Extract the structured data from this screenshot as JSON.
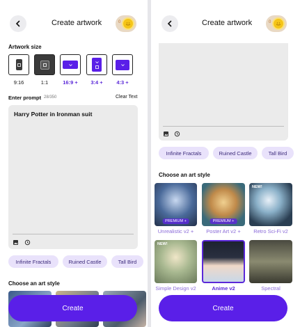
{
  "header": {
    "title": "Create artwork",
    "credits": "0"
  },
  "left": {
    "artwork_size_label": "Artwork size",
    "sizes": [
      {
        "ratio": "9:16",
        "pro": false,
        "selected": false
      },
      {
        "ratio": "1:1",
        "pro": false,
        "selected": true
      },
      {
        "ratio": "16:9 +",
        "pro": true,
        "selected": false
      },
      {
        "ratio": "3:4 +",
        "pro": true,
        "selected": false
      },
      {
        "ratio": "4:3 +",
        "pro": true,
        "selected": false
      }
    ],
    "prompt_label": "Enter prompt",
    "prompt_count": "28/350",
    "clear_text": "Clear Text",
    "prompt_value": "Harry Potter in Ironman suit",
    "chips": [
      "Infinite Fractals",
      "Ruined Castle",
      "Tall Bird"
    ],
    "art_style_label": "Choose an art style",
    "create_label": "Create"
  },
  "right": {
    "chips": [
      "Infinite Fractals",
      "Ruined Castle",
      "Tall Bird"
    ],
    "art_style_label": "Choose an art style",
    "styles": [
      {
        "name": "Unrealistic v2 +",
        "badge": "PREMIUM +",
        "is_new": false,
        "selected": false
      },
      {
        "name": "Poster Art v2 +",
        "badge": "PREMIUM +",
        "is_new": false,
        "selected": false
      },
      {
        "name": "Retro Sci-Fi v2",
        "badge": "",
        "is_new": true,
        "selected": false
      },
      {
        "name": "Simple Design v2",
        "badge": "",
        "is_new": true,
        "selected": false
      },
      {
        "name": "Anime v2",
        "badge": "",
        "is_new": false,
        "selected": true
      },
      {
        "name": "Spectral",
        "badge": "",
        "is_new": false,
        "selected": false
      }
    ],
    "new_badge": "NEW!",
    "create_label": "Create"
  },
  "colors": {
    "accent": "#5a1fe8",
    "chip_bg": "#e9e2fb",
    "prompt_bg": "#ebebeb",
    "coin": "#f5c518"
  },
  "icons": [
    "back-arrow-icon",
    "coin-icon",
    "image-upload-icon",
    "history-icon"
  ]
}
